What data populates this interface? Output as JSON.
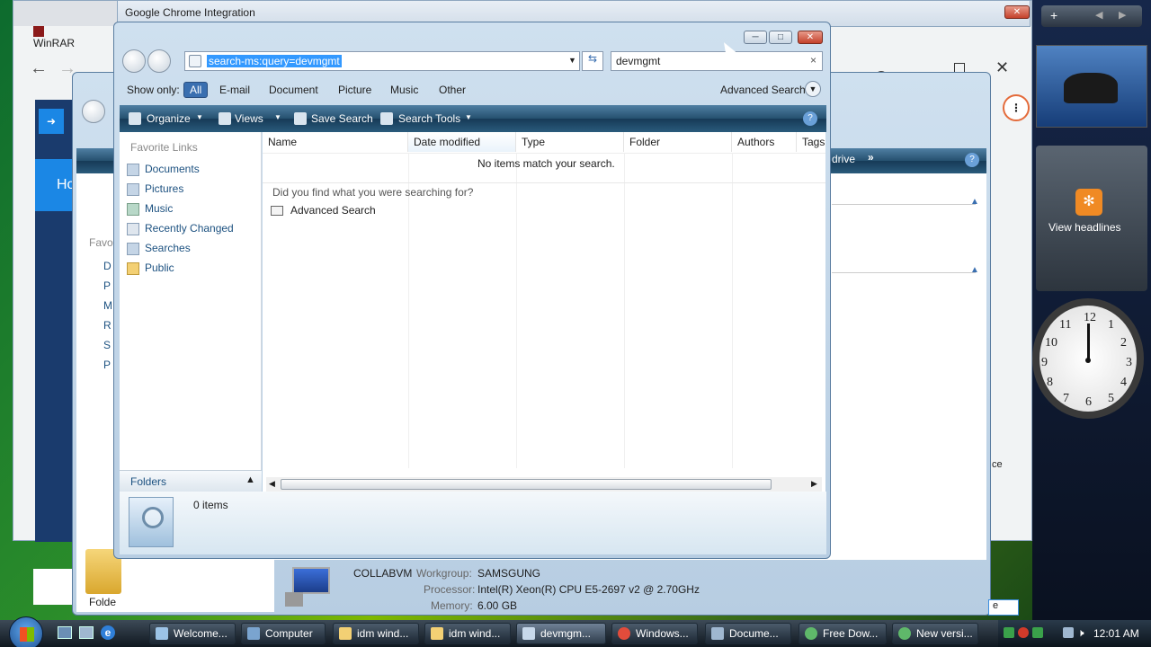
{
  "main_window": {
    "address_value": "search-ms:query=devmgmt",
    "search_box_value": "devmgmt",
    "show_only_label": "Show only:",
    "filters": [
      "All",
      "E-mail",
      "Document",
      "Picture",
      "Music",
      "Other"
    ],
    "advanced_search_label": "Advanced Search",
    "toolbar": {
      "organize": "Organize",
      "views": "Views",
      "save_search": "Save Search",
      "search_tools": "Search Tools"
    },
    "favorite_links_header": "Favorite Links",
    "favorite_links": [
      "Documents",
      "Pictures",
      "Music",
      "Recently Changed",
      "Searches",
      "Public"
    ],
    "folders_label": "Folders",
    "columns": [
      "Name",
      "Date modified",
      "Type",
      "Folder",
      "Authors",
      "Tags"
    ],
    "empty_message": "No items match your search.",
    "did_you_find": "Did you find what you were searching for?",
    "advanced_search_link": "Advanced Search",
    "status": "0 items"
  },
  "back_window": {
    "title": "Google Chrome Integration",
    "computer_name": "COLLABVM",
    "workgroup_label": "Workgroup:",
    "workgroup_value": "SAMSGUNG",
    "processor_label": "Processor:",
    "processor_value": "Intel(R) Xeon(R) CPU E5-2697 v2 @ 2.70GHz",
    "memory_label": "Memory:",
    "memory_value": "6.00 GB",
    "drive_fragment": "drive",
    "left_nav_fragments": [
      "Favo",
      "D",
      "P",
      "M",
      "R",
      "S",
      "P"
    ],
    "folders_fragment": "Folde",
    "ce_fragment": "ce",
    "e_fragment": "e"
  },
  "chrome": {
    "tab_fragment": "WinRAR",
    "ho_fragment": "Ho"
  },
  "sidebar": {
    "feed_label": "View headlines",
    "clock_numbers": [
      "12",
      "1",
      "2",
      "3",
      "4",
      "5",
      "6",
      "7",
      "8",
      "9",
      "10",
      "11"
    ]
  },
  "taskbar": {
    "buttons": [
      "Welcome...",
      "Computer",
      "idm wind...",
      "idm wind...",
      "devmgm...",
      "Windows...",
      "Docume...",
      "Free Dow...",
      "New versi..."
    ],
    "time": "12:01 AM"
  }
}
